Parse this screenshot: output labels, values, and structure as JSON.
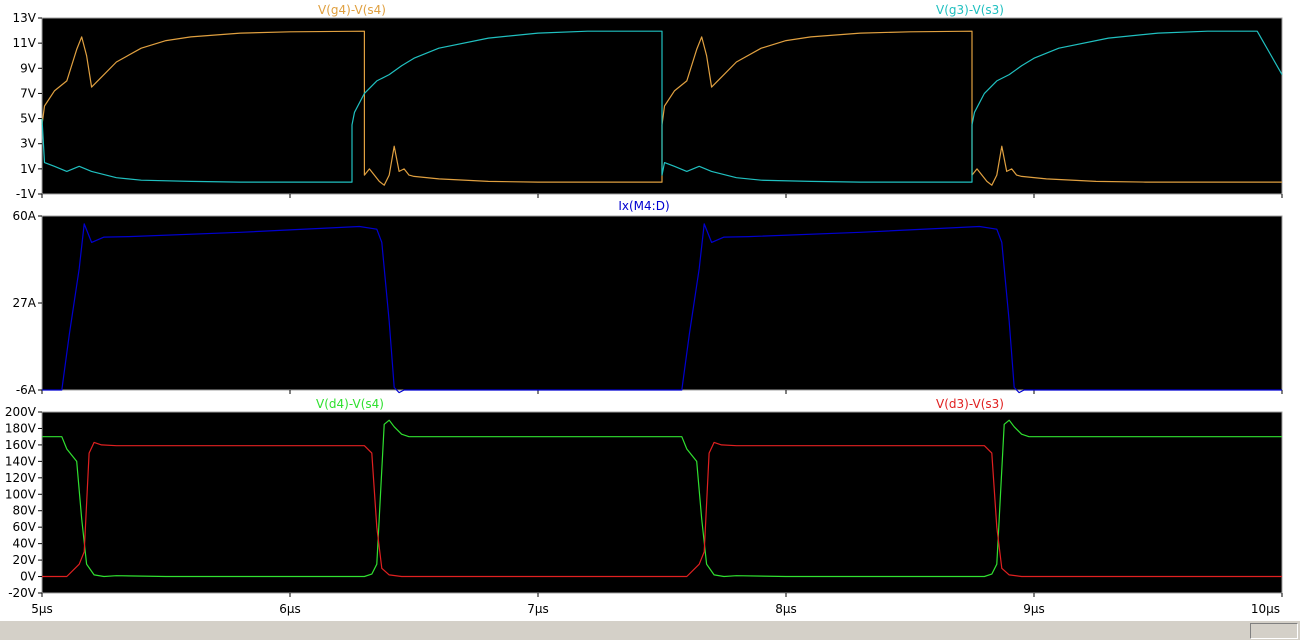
{
  "window": {
    "background": "#ffffff",
    "plot_background": "#000000",
    "frame_color": "#a0a0a0"
  },
  "chart_data": [
    {
      "type": "line",
      "xlim": [
        5,
        10
      ],
      "x_unit": "µs",
      "ylim": [
        -1,
        13
      ],
      "yticks": [
        "-1V",
        "1V",
        "3V",
        "5V",
        "7V",
        "9V",
        "11V",
        "13V"
      ],
      "ytick_values": [
        -1,
        1,
        3,
        5,
        7,
        9,
        11,
        13
      ],
      "series": [
        {
          "name": "V(g4)-V(s4)",
          "color": "#e0a040",
          "kind": "gate",
          "x": [
            5.0,
            5.01,
            5.05,
            5.1,
            5.14,
            5.16,
            5.18,
            5.2,
            5.25,
            5.3,
            5.4,
            5.5,
            5.6,
            5.8,
            6.0,
            6.3,
            6.3,
            6.32,
            6.36,
            6.38,
            6.4,
            6.42,
            6.44,
            6.46,
            6.48,
            6.5,
            6.6,
            6.8,
            7.0,
            7.2,
            7.4,
            7.5,
            7.5,
            7.51,
            7.55,
            7.6,
            7.64,
            7.66,
            7.68,
            7.7,
            7.75,
            7.8,
            7.9,
            8.0,
            8.1,
            8.3,
            8.5,
            8.75,
            8.75,
            8.77,
            8.81,
            8.83,
            8.85,
            8.87,
            8.89,
            8.91,
            8.93,
            8.95,
            9.05,
            9.25,
            9.45,
            9.65,
            9.85,
            10.0
          ],
          "y": [
            4.5,
            6,
            7.2,
            8,
            10.5,
            11.5,
            10,
            7.5,
            8.5,
            9.5,
            10.6,
            11.2,
            11.5,
            11.8,
            11.9,
            11.95,
            0.5,
            1,
            0,
            -0.3,
            0.5,
            2.8,
            0.8,
            1,
            0.5,
            0.4,
            0.2,
            0,
            -0.05,
            -0.05,
            -0.05,
            -0.05,
            4.5,
            6,
            7.2,
            8,
            10.5,
            11.5,
            10,
            7.5,
            8.5,
            9.5,
            10.6,
            11.2,
            11.5,
            11.8,
            11.9,
            11.95,
            0.5,
            1,
            0,
            -0.3,
            0.5,
            2.8,
            0.8,
            1,
            0.5,
            0.4,
            0.2,
            0,
            -0.05,
            -0.05,
            -0.05,
            -0.05
          ]
        },
        {
          "name": "V(g3)-V(s3)",
          "color": "#20c0c0",
          "kind": "gate",
          "x": [
            5.0,
            5.01,
            5.05,
            5.1,
            5.15,
            5.2,
            5.3,
            5.4,
            5.6,
            5.8,
            6.0,
            6.25,
            6.25,
            6.26,
            6.3,
            6.35,
            6.4,
            6.45,
            6.5,
            6.6,
            6.8,
            7.0,
            7.2,
            7.4,
            7.5,
            7.5,
            7.51,
            7.55,
            7.6,
            7.65,
            7.7,
            7.8,
            7.9,
            8.1,
            8.3,
            8.5,
            8.75,
            8.75,
            8.76,
            8.8,
            8.85,
            8.9,
            8.95,
            9.0,
            9.1,
            9.3,
            9.5,
            9.7,
            9.9,
            10.0
          ],
          "y": [
            5,
            1.5,
            1.2,
            0.8,
            1.2,
            0.8,
            0.3,
            0.1,
            0,
            -0.05,
            -0.05,
            -0.05,
            4.5,
            5.5,
            7,
            8,
            8.5,
            9.2,
            9.8,
            10.6,
            11.4,
            11.8,
            11.95,
            11.95,
            11.95,
            0.5,
            1.5,
            1.2,
            0.8,
            1.2,
            0.8,
            0.3,
            0.1,
            0,
            -0.05,
            -0.05,
            -0.05,
            4.5,
            5.5,
            7,
            8,
            8.5,
            9.2,
            9.8,
            10.6,
            11.4,
            11.8,
            11.95,
            11.95,
            8.5
          ]
        }
      ]
    },
    {
      "type": "line",
      "xlim": [
        5,
        10
      ],
      "x_unit": "µs",
      "ylim": [
        -6,
        60
      ],
      "yticks": [
        "-6A",
        "27A",
        "60A"
      ],
      "ytick_values": [
        -6,
        27,
        60
      ],
      "series": [
        {
          "name": "Ix(M4:D)",
          "color": "#0000d0",
          "kind": "current",
          "x": [
            5.0,
            5.08,
            5.11,
            5.15,
            5.17,
            5.2,
            5.25,
            5.35,
            5.8,
            6.28,
            6.35,
            6.37,
            6.4,
            6.42,
            6.44,
            6.46,
            6.5,
            7.0,
            7.58,
            7.61,
            7.65,
            7.67,
            7.7,
            7.75,
            7.85,
            8.3,
            8.78,
            8.85,
            8.87,
            8.9,
            8.92,
            8.94,
            8.96,
            9.0,
            10.0
          ],
          "y": [
            -6,
            -6,
            15,
            40,
            57,
            50,
            52,
            52.2,
            53.8,
            56,
            55,
            50,
            20,
            -5,
            -7,
            -6,
            -6,
            -6,
            -6,
            15,
            40,
            57,
            50,
            52,
            52.2,
            53.8,
            56,
            55,
            50,
            20,
            -5,
            -7,
            -6,
            -6,
            -6
          ]
        }
      ]
    },
    {
      "type": "line",
      "xlim": [
        5,
        10
      ],
      "x_unit": "µs",
      "xticks": [
        "5µs",
        "6µs",
        "7µs",
        "8µs",
        "9µs",
        "10µs"
      ],
      "xtick_values": [
        5,
        6,
        7,
        8,
        9,
        10
      ],
      "ylim": [
        -20,
        200
      ],
      "yticks": [
        "-20V",
        "0V",
        "20V",
        "40V",
        "60V",
        "80V",
        "100V",
        "120V",
        "140V",
        "160V",
        "180V",
        "200V"
      ],
      "ytick_values": [
        -20,
        0,
        20,
        40,
        60,
        80,
        100,
        120,
        140,
        160,
        180,
        200
      ],
      "series": [
        {
          "name": "V(d4)-V(s4)",
          "color": "#30e030",
          "kind": "drain",
          "x": [
            5.0,
            5.08,
            5.1,
            5.14,
            5.16,
            5.18,
            5.21,
            5.25,
            5.3,
            5.5,
            5.8,
            6.0,
            6.3,
            6.33,
            6.35,
            6.38,
            6.4,
            6.42,
            6.45,
            6.48,
            6.55,
            6.8,
            7.0,
            7.2,
            7.4,
            7.58,
            7.6,
            7.64,
            7.66,
            7.68,
            7.71,
            7.75,
            7.8,
            8.0,
            8.3,
            8.5,
            8.8,
            8.83,
            8.85,
            8.88,
            8.9,
            8.92,
            8.95,
            8.98,
            9.05,
            9.3,
            9.5,
            9.7,
            10.0
          ],
          "y": [
            170,
            170,
            155,
            140,
            70,
            15,
            2,
            0,
            1,
            0,
            0,
            0,
            0,
            3,
            15,
            185,
            190,
            182,
            173,
            170,
            170,
            170,
            170,
            170,
            170,
            170,
            155,
            140,
            70,
            15,
            2,
            0,
            1,
            0,
            0,
            0,
            0,
            3,
            15,
            185,
            190,
            182,
            173,
            170,
            170,
            170,
            170,
            170,
            170
          ]
        }
      ]
    }
  ],
  "overlay": {
    "series_3": {
      "name": "V(d3)-V(s3)",
      "color": "#e02020",
      "kind": "drain",
      "x": [
        5.0,
        5.1,
        5.15,
        5.17,
        5.19,
        5.21,
        5.24,
        5.3,
        5.5,
        5.8,
        6.0,
        6.3,
        6.33,
        6.35,
        6.37,
        6.4,
        6.45,
        6.55,
        6.8,
        7.0,
        7.2,
        7.4,
        7.6,
        7.65,
        7.67,
        7.69,
        7.71,
        7.74,
        7.8,
        8.0,
        8.3,
        8.5,
        8.8,
        8.83,
        8.85,
        8.87,
        8.9,
        8.95,
        9.05,
        9.3,
        9.5,
        9.7,
        10.0
      ],
      "y": [
        0,
        0,
        15,
        30,
        150,
        163,
        160,
        159,
        159,
        159,
        159,
        159,
        150,
        60,
        10,
        2,
        0,
        0,
        0,
        0,
        0,
        0,
        0,
        15,
        30,
        150,
        163,
        160,
        159,
        159,
        159,
        159,
        159,
        150,
        60,
        10,
        2,
        0,
        0,
        0,
        0,
        0,
        0
      ]
    }
  }
}
